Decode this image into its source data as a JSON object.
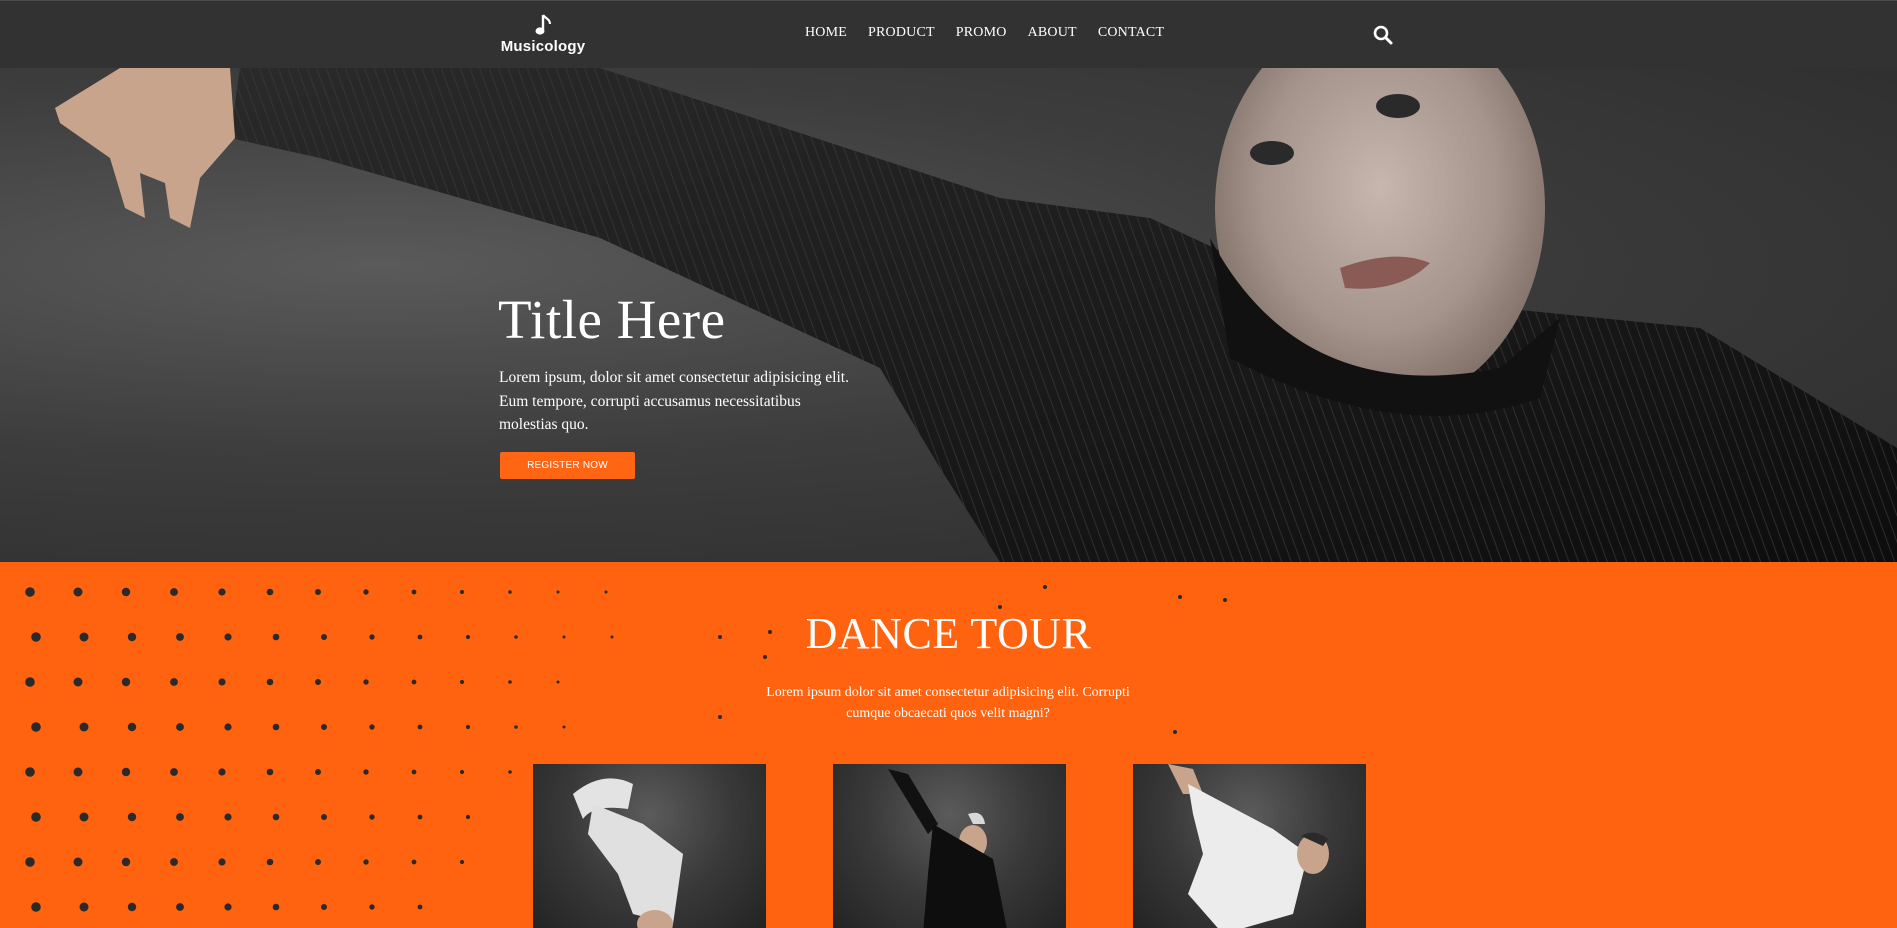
{
  "brand": {
    "name": "Musicology",
    "logo_icon": "music-note-icon"
  },
  "nav": {
    "items": [
      {
        "label": "HOME"
      },
      {
        "label": "PRODUCT"
      },
      {
        "label": "PROMO"
      },
      {
        "label": "ABOUT"
      },
      {
        "label": "CONTACT"
      }
    ],
    "search_icon": "search-icon"
  },
  "hero": {
    "title": "Title Here",
    "description": "Lorem ipsum, dolor sit amet consectetur adipisicing elit. Eum tempore, corrupti accusamus necessitatibus molestias quo.",
    "button_label": "REGISTER NOW",
    "image": "dancer-in-black-sweater-photo"
  },
  "tour": {
    "title": "DANCE TOUR",
    "description": "Lorem ipsum dolor sit amet consectetur adipisicing elit. Corrupti cumque obcaecati quos velit magni?",
    "cards": [
      {
        "image": "breakdancer-white-outfit-photo"
      },
      {
        "image": "dancer-black-outfit-photo"
      },
      {
        "image": "dancer-white-outfit-crouch-photo"
      }
    ]
  },
  "colors": {
    "navbar": "#323232",
    "accent": "#ff6513",
    "tour_background": "#ff630f",
    "text": "#ffffff"
  }
}
